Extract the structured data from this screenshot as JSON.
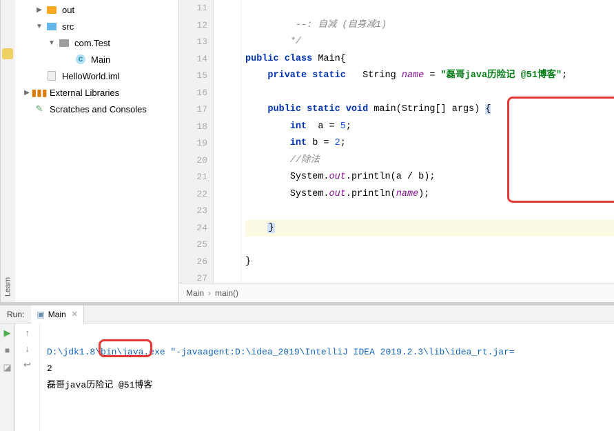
{
  "learn_tab": "Learn",
  "tree": {
    "out": "out",
    "src": "src",
    "package": "com.Test",
    "main_class": "Main",
    "iml": "HelloWorld.iml",
    "ext_libs": "External Libraries",
    "scratches": "Scratches and Consoles"
  },
  "gutter": [
    "11",
    "12",
    "13",
    "14",
    "15",
    "16",
    "17",
    "18",
    "19",
    "20",
    "21",
    "22",
    "23",
    "24",
    "25",
    "26",
    "27"
  ],
  "code": {
    "l11": "--: 自减 (自身减1)",
    "l12": "*/",
    "l13_kw1": "public class",
    "l13_name": " Main{",
    "l14_kw1": "private static",
    "l14_type": "   String ",
    "l14_field": "name",
    "l14_eq": " = ",
    "l14_str": "\"磊哥java历险记 @51博客\"",
    "l14_semi": ";",
    "l16_kw": "public static void",
    "l16_sig": " main(String[] args) ",
    "l16_brace": "{",
    "l17_kw": "int",
    "l17_rest": "  a = ",
    "l17_n": "5",
    "l17_s": ";",
    "l18_kw": "int",
    "l18_rest": " b = ",
    "l18_n": "2",
    "l18_s": ";",
    "l19": "//除法",
    "l20a": "System.",
    "l20out": "out",
    "l20b": ".println(a / b);",
    "l21a": "System.",
    "l21out": "out",
    "l21b": ".println(",
    "l21name": "name",
    "l21c": ");",
    "l23": "}",
    "l24": "}"
  },
  "breadcrumb": {
    "a": "Main",
    "b": "main()"
  },
  "run": {
    "label": "Run:",
    "tab": "Main",
    "cmd": "D:\\jdk1.8\\bin\\java.exe \"-javaagent:D:\\idea_2019\\IntelliJ IDEA 2019.2.3\\lib\\idea_rt.jar=",
    "out1": "2",
    "out2": "磊哥java历险记 @51博客"
  }
}
